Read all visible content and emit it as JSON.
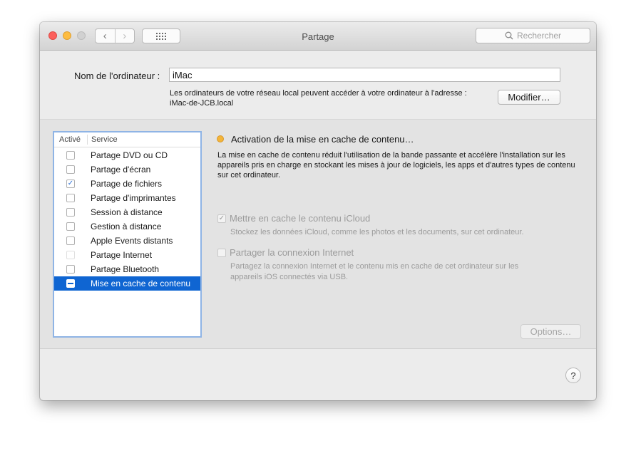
{
  "window": {
    "title": "Partage",
    "search_placeholder": "Rechercher",
    "nav_back_glyph": "‹",
    "nav_forward_glyph": "›"
  },
  "computer_name": {
    "label": "Nom de l'ordinateur :",
    "value": "iMac",
    "address_line1": "Les ordinateurs de votre réseau local peuvent accéder à votre ordinateur à l'adresse :",
    "address_line2": "iMac-de-JCB.local",
    "modify_button": "Modifier…"
  },
  "services": {
    "column_active": "Activé",
    "column_service": "Service",
    "items": [
      {
        "label": "Partage DVD ou CD",
        "checked": false
      },
      {
        "label": "Partage d'écran",
        "checked": false
      },
      {
        "label": "Partage de fichiers",
        "checked": true
      },
      {
        "label": "Partage d'imprimantes",
        "checked": false
      },
      {
        "label": "Session à distance",
        "checked": false
      },
      {
        "label": "Gestion à distance",
        "checked": false
      },
      {
        "label": "Apple Events distants",
        "checked": false
      },
      {
        "label": "Partage Internet",
        "checked": false
      },
      {
        "label": "Partage Bluetooth",
        "checked": false
      },
      {
        "label": "Mise en cache de contenu",
        "checked": "mixed",
        "selected": true
      }
    ]
  },
  "detail": {
    "status_color": "#f3b53a",
    "status_title": "Activation de la mise en cache de contenu…",
    "description": "La mise en cache de contenu réduit l'utilisation de la bande passante et accélère l'installation sur les appareils pris en charge en stockant les mises à jour de logiciels, les apps et d'autres types de contenu sur cet ordinateur.",
    "option1_label": "Mettre en cache le contenu iCloud",
    "option1_desc": "Stockez les données iCloud, comme les photos et les documents, sur cet ordinateur.",
    "option2_label": "Partager la connexion Internet",
    "option2_desc_line1": "Partagez la connexion Internet et le contenu mis en cache de cet ordinateur sur les",
    "option2_desc_line2": "appareils iOS connectés via USB.",
    "options_button": "Options…"
  },
  "help_glyph": "?"
}
